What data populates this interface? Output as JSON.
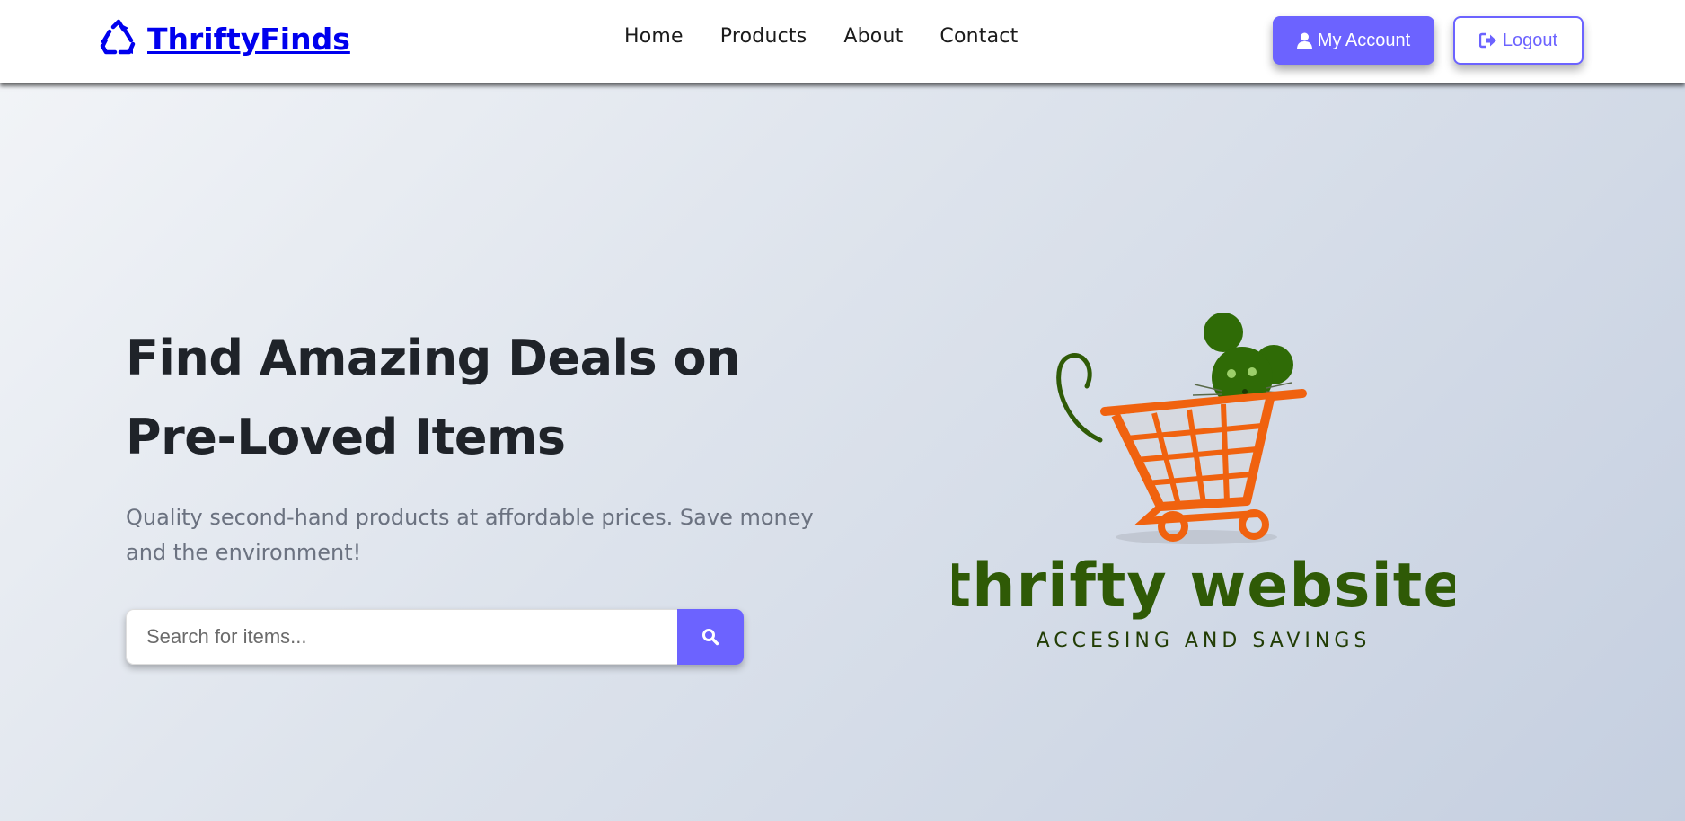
{
  "brand": {
    "name": "ThriftyFinds",
    "icon": "recycle-icon"
  },
  "nav": {
    "links": [
      {
        "label": "Home"
      },
      {
        "label": "Products"
      },
      {
        "label": "About"
      },
      {
        "label": "Contact"
      }
    ]
  },
  "account": {
    "my_account_label": "My Account",
    "my_account_icon": "user-icon",
    "logout_label": "Logout",
    "logout_icon": "sign-out-icon"
  },
  "hero": {
    "title": "Find Amazing Deals on Pre-Loved Items",
    "subtitle": "Quality second-hand products at affordable prices. Save money and the environment!"
  },
  "search": {
    "placeholder": "Search for items...",
    "value": "",
    "button_icon": "search-icon"
  },
  "logo_image": {
    "wordmark": "thrifty website",
    "tagline": "ACCESING AND SAVINGS"
  },
  "colors": {
    "accent": "#6c63ff",
    "brand_link": "#0000ee",
    "cart_orange": "#f0620f",
    "logo_green": "#2f5a06"
  }
}
